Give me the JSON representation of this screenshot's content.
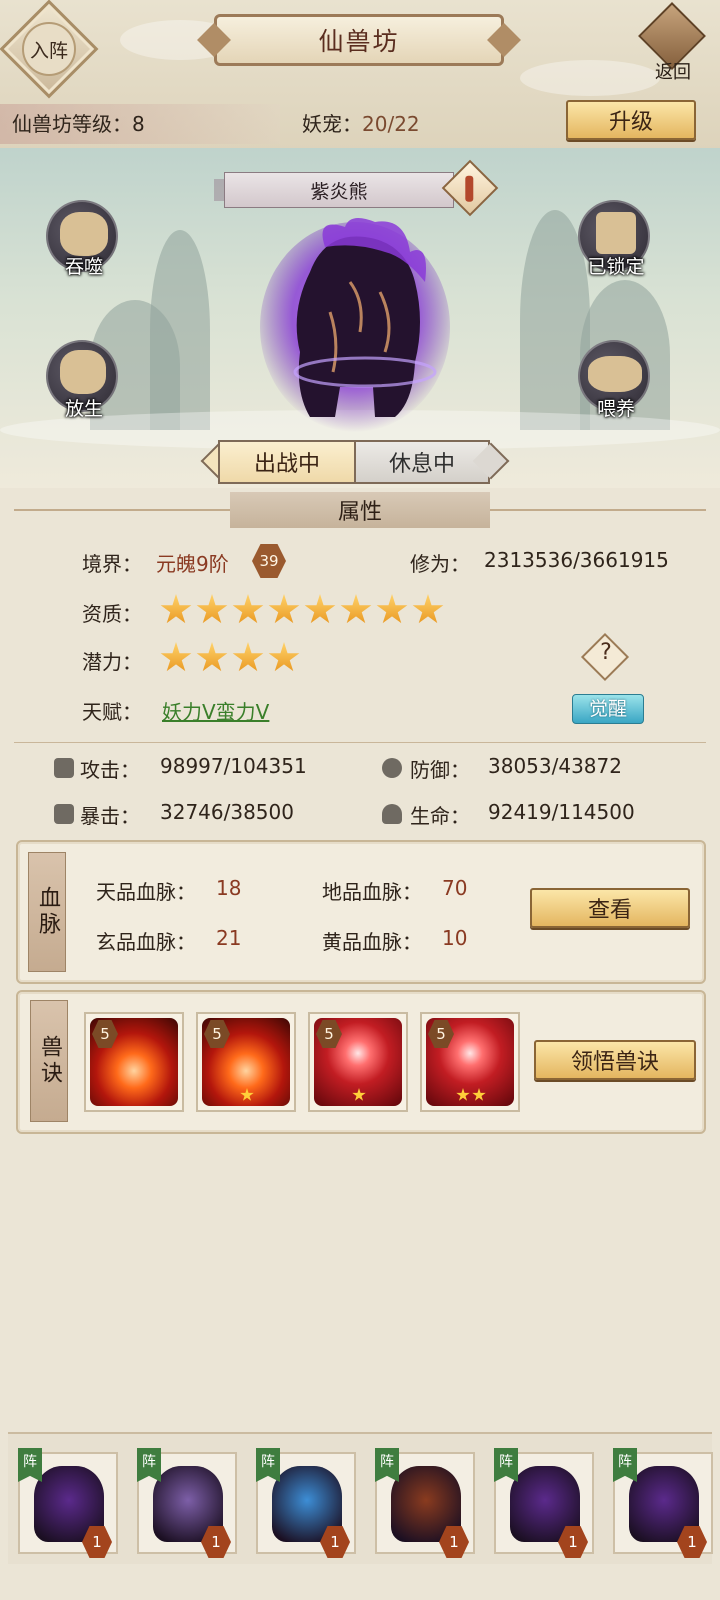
{
  "header": {
    "formation_label": "入阵",
    "title": "仙兽坊",
    "back_label": "返回",
    "level_label": "仙兽坊等级：",
    "level_value": "8",
    "pets_label": "妖宠：",
    "pets_value": "20/22",
    "upgrade_label": "升级"
  },
  "pet": {
    "name": "紫炎熊",
    "actions": {
      "devour": "吞噬",
      "locked": "已锁定",
      "release": "放生",
      "feed": "喂养"
    },
    "status_tabs": [
      "出战中",
      "休息中"
    ],
    "active_tab": "出战中"
  },
  "attributes": {
    "section_title": "属性",
    "realm_label": "境界：",
    "realm_value": "元魄9阶",
    "realm_level": "39",
    "cultivation_label": "修为：",
    "cultivation_value": "2313536/3661915",
    "aptitude_label": "资质：",
    "aptitude_stars": 8,
    "potential_label": "潜力：",
    "potential_stars": 4,
    "talent_label": "天赋：",
    "talent_value": "妖力V蛮力V",
    "awaken_label": "觉醒",
    "help_label": "?",
    "attack_label": "攻击：",
    "attack_value": "98997/104351",
    "defense_label": "防御：",
    "defense_value": "38053/43872",
    "crit_label": "暴击：",
    "crit_value": "32746/38500",
    "hp_label": "生命：",
    "hp_value": "92419/114500"
  },
  "bloodline": {
    "tag": "血脉",
    "heaven_label": "天品血脉：",
    "heaven_value": "18",
    "earth_label": "地品血脉：",
    "earth_value": "70",
    "mystic_label": "玄品血脉：",
    "mystic_value": "21",
    "yellow_label": "黄品血脉：",
    "yellow_value": "10",
    "view_label": "查看"
  },
  "skills": {
    "tag": "兽诀",
    "learn_label": "领悟兽诀",
    "items": [
      {
        "level": "5",
        "stars": 0,
        "icon": "fire-beast-icon"
      },
      {
        "level": "5",
        "stars": 1,
        "icon": "fire-beast-icon"
      },
      {
        "level": "5",
        "stars": 1,
        "icon": "red-swirl-icon"
      },
      {
        "level": "5",
        "stars": 2,
        "icon": "red-swirl-icon"
      }
    ]
  },
  "roster": {
    "flag_label": "阵",
    "pets": [
      {
        "level": "1",
        "icon": "purple-bear-icon",
        "color": "#5b2a8c"
      },
      {
        "level": "1",
        "icon": "rhino-icon",
        "color": "#7d5fa8"
      },
      {
        "level": "1",
        "icon": "blue-phoenix-icon",
        "color": "#3d8ed6"
      },
      {
        "level": "1",
        "icon": "fire-ape-icon",
        "color": "#8a3b1f"
      },
      {
        "level": "1",
        "icon": "purple-bear-icon",
        "color": "#5b2a8c"
      },
      {
        "level": "1",
        "icon": "purple-bear-icon",
        "color": "#5b2a8c"
      }
    ]
  },
  "colors": {
    "accent_red": "#8a3a22",
    "talent_green": "#3a7f2a",
    "gold": "#e4b660",
    "awaken_blue": "#3aa6c4"
  }
}
